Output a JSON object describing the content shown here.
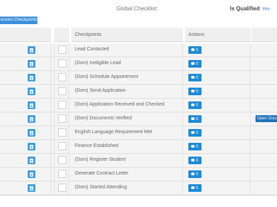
{
  "header": {
    "global_title": "Global Checklist:",
    "qualified_label": "Is Qualified",
    "qualified_value": "Yes"
  },
  "extension_button": "ension Checkpoints",
  "table": {
    "columns": [
      "",
      "",
      "Checkpoints",
      "Actions",
      ""
    ],
    "rows": [
      {
        "label": "Lead Contacted",
        "comments": "0"
      },
      {
        "label": "(Dom) Ineligible Lead",
        "comments": "0"
      },
      {
        "label": "(Dom) Schedule Appointment",
        "comments": "0"
      },
      {
        "label": "(Dom) Send Application",
        "comments": "0"
      },
      {
        "label": "(Dom) Application Received and Checked",
        "comments": "0"
      },
      {
        "label": "(Dom) Documents Verified",
        "comments": "0",
        "extra_button": "Open Docu"
      },
      {
        "label": "English Language Requirement Met",
        "comments": "0"
      },
      {
        "label": "Finance Established",
        "comments": "0"
      },
      {
        "label": "(Dom) Register Student",
        "comments": "0"
      },
      {
        "label": "Generate Contract Letter",
        "comments": "0"
      },
      {
        "label": "(Dom) Started Attending",
        "comments": "0"
      }
    ]
  },
  "colors": {
    "primary_button": "#3b8fdd",
    "comment_button": "#1e8ad6",
    "open_button": "#1f6fb8",
    "header_bg": "#efefef",
    "row_bg": "#f4f4f4"
  },
  "icons": {
    "document": "document-icon",
    "comment": "comment-icon"
  }
}
